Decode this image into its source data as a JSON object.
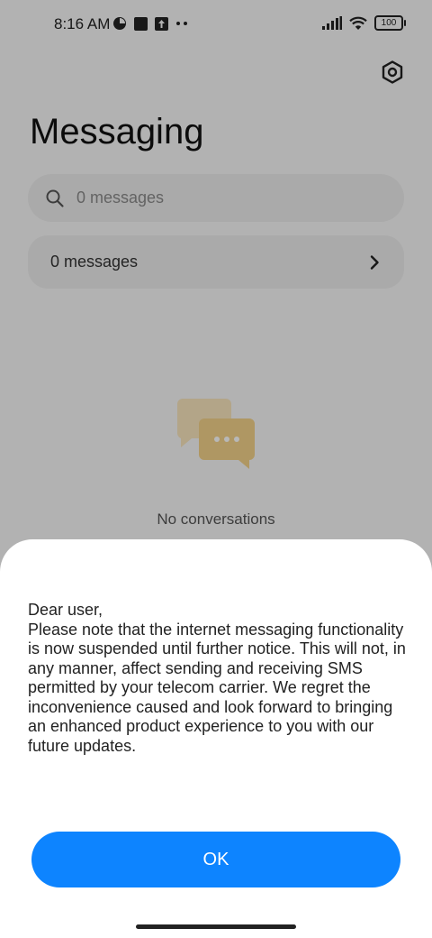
{
  "status_bar": {
    "time": "8:16 AM",
    "battery": "100",
    "left_icons": [
      "pie-status-icon",
      "square-status-icon",
      "upload-status-icon",
      "more-dots-icon"
    ],
    "right_icons": [
      "signal-icon",
      "wifi-icon",
      "battery-icon"
    ]
  },
  "header": {
    "title": "Messaging",
    "settings_icon": "hexagon-settings-icon"
  },
  "search": {
    "placeholder": "0 messages"
  },
  "messages_row": {
    "label": "0 messages"
  },
  "empty_state": {
    "text": "No conversations",
    "icon": "chat-bubbles-icon",
    "icon_color": "#f3d28a"
  },
  "dialog": {
    "message": "Dear user,\nPlease note that the internet messaging functionality is now suspended until further notice. This will not, in any manner, affect sending and receiving SMS permitted by your telecom carrier. We regret the inconvenience caused and look forward to bringing an enhanced product experience to you with our future updates.",
    "ok_label": "OK",
    "accent_color": "#0d84ff"
  }
}
